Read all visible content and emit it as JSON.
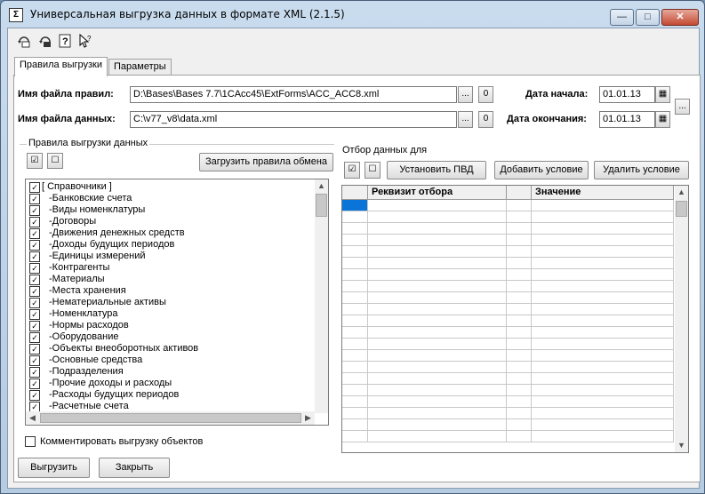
{
  "window": {
    "title": "Универсальная выгрузка данных в формате XML (2.1.5)",
    "minimize_glyph": "—",
    "maximize_glyph": "□",
    "close_glyph": "✕"
  },
  "toolbar": {
    "icons": [
      "open-rules-icon",
      "save-rules-icon",
      "help-icon",
      "context-help-icon"
    ]
  },
  "tabs": [
    "Правила выгрузки",
    "Параметры"
  ],
  "rules_file": {
    "label": "Имя файла правил:",
    "value": "D:\\Bases\\Bases 7.7\\1CAcc45\\ExtForms\\ACC_ACC8.xml",
    "browse_label": "...",
    "open_label": "0"
  },
  "data_file": {
    "label": "Имя файла данных:",
    "value": "C:\\v77_v8\\data.xml",
    "browse_label": "...",
    "open_label": "0"
  },
  "date_start": {
    "label": "Дата начала:",
    "value": "01.01.13"
  },
  "date_end": {
    "label": "Дата окончания:",
    "value": "01.01.13"
  },
  "period_button_label": "...",
  "rules_group": {
    "title": "Правила выгрузки данных",
    "load_button": "Загрузить правила обмена",
    "root_label": "[ Справочники ]",
    "items": [
      "-Банковские счета",
      "-Виды номенклатуры",
      "-Договоры",
      "-Движения денежных средств",
      "-Доходы будущих периодов",
      "-Единицы измерений",
      "-Контрагенты",
      "-Материалы",
      "-Места хранения",
      "-Нематериальные активы",
      "-Номенклатура",
      "-Нормы расходов",
      "-Оборудование",
      "-Объекты внеоборотных активов",
      "-Основные средства",
      "-Подразделения",
      "-Прочие доходы и расходы",
      "-Расходы будущих периодов",
      "-Расчетные счета"
    ]
  },
  "filter_group": {
    "title": "Отбор данных для",
    "set_pvd_button": "Установить ПВД",
    "add_condition_button": "Добавить условие",
    "remove_condition_button": "Удалить условие",
    "columns": [
      "Реквизит отбора",
      "Значение"
    ]
  },
  "comment_checkbox_label": "Комментировать выгрузку объектов",
  "buttons": {
    "export": "Выгрузить",
    "close": "Закрыть"
  },
  "colors": {
    "selection": "#0a74d8",
    "titlebar": "#b9cfe6"
  }
}
